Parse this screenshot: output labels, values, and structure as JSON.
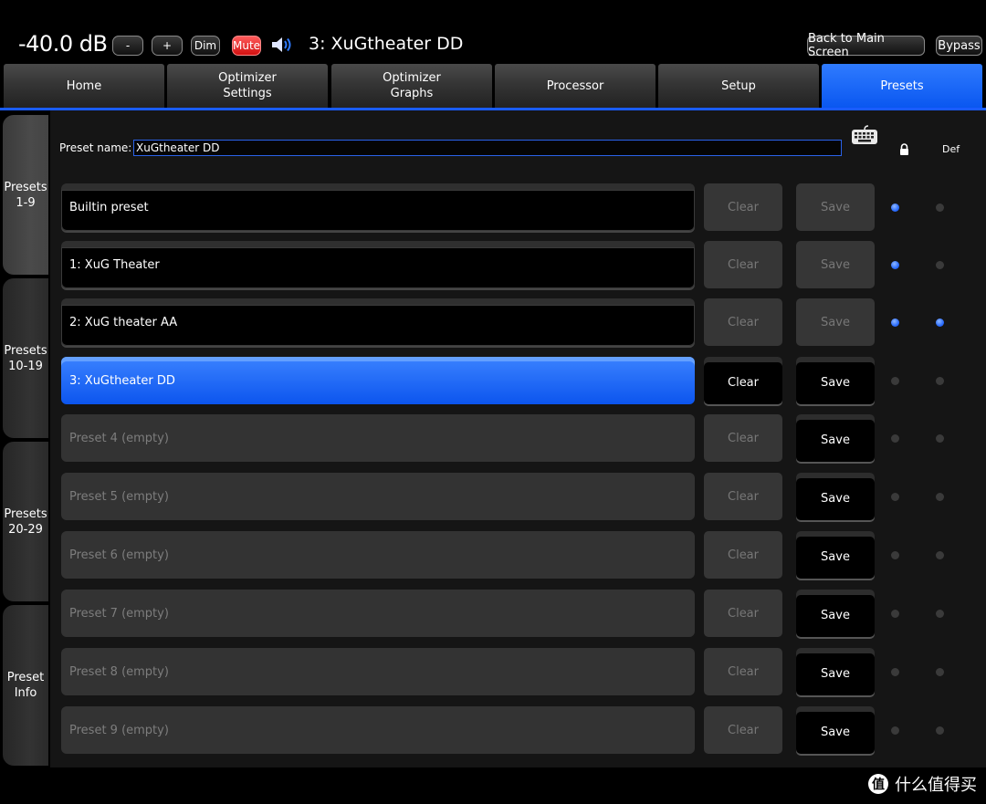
{
  "header": {
    "volume": "-40.0 dB",
    "minus_label": "-",
    "plus_label": "+",
    "dim_label": "Dim",
    "mute_label": "Mute",
    "current_preset": "3: XuGtheater DD",
    "back_label": "Back to Main Screen",
    "bypass_label": "Bypass"
  },
  "tabs": [
    {
      "label": "Home"
    },
    {
      "label": "Optimizer\nSettings"
    },
    {
      "label": "Optimizer\nGraphs"
    },
    {
      "label": "Processor"
    },
    {
      "label": "Setup"
    },
    {
      "label": "Presets"
    }
  ],
  "side_tabs": [
    {
      "label": "Presets\n1-9"
    },
    {
      "label": "Presets\n10-19"
    },
    {
      "label": "Presets\n20-29"
    },
    {
      "label": "Preset\nInfo"
    }
  ],
  "preset_name": {
    "label": "Preset name:",
    "value": "XuGtheater DD"
  },
  "columns": {
    "def_label": "Def"
  },
  "presets": [
    {
      "label": "Builtin preset",
      "state": "filled",
      "clear": "Clear",
      "save": "Save",
      "clear_enabled": false,
      "save_enabled": false,
      "lock": true,
      "def": false
    },
    {
      "label": "1: XuG Theater",
      "state": "filled",
      "clear": "Clear",
      "save": "Save",
      "clear_enabled": false,
      "save_enabled": false,
      "lock": true,
      "def": false
    },
    {
      "label": "2: XuG theater AA",
      "state": "filled",
      "clear": "Clear",
      "save": "Save",
      "clear_enabled": false,
      "save_enabled": false,
      "lock": true,
      "def": true
    },
    {
      "label": "3: XuGtheater DD",
      "state": "active",
      "clear": "Clear",
      "save": "Save",
      "clear_enabled": true,
      "save_enabled": true,
      "lock": false,
      "def": false
    },
    {
      "label": "Preset 4 (empty)",
      "state": "empty",
      "clear": "Clear",
      "save": "Save",
      "clear_enabled": false,
      "save_enabled": true,
      "lock": false,
      "def": false
    },
    {
      "label": "Preset 5 (empty)",
      "state": "empty",
      "clear": "Clear",
      "save": "Save",
      "clear_enabled": false,
      "save_enabled": true,
      "lock": false,
      "def": false
    },
    {
      "label": "Preset 6 (empty)",
      "state": "empty",
      "clear": "Clear",
      "save": "Save",
      "clear_enabled": false,
      "save_enabled": true,
      "lock": false,
      "def": false
    },
    {
      "label": "Preset 7 (empty)",
      "state": "empty",
      "clear": "Clear",
      "save": "Save",
      "clear_enabled": false,
      "save_enabled": true,
      "lock": false,
      "def": false
    },
    {
      "label": "Preset 8 (empty)",
      "state": "empty",
      "clear": "Clear",
      "save": "Save",
      "clear_enabled": false,
      "save_enabled": true,
      "lock": false,
      "def": false
    },
    {
      "label": "Preset 9 (empty)",
      "state": "empty",
      "clear": "Clear",
      "save": "Save",
      "clear_enabled": false,
      "save_enabled": true,
      "lock": false,
      "def": false
    }
  ],
  "watermark": {
    "text": "什么值得买"
  },
  "colors": {
    "accent": "#0c55ee",
    "mute": "#e01818"
  }
}
